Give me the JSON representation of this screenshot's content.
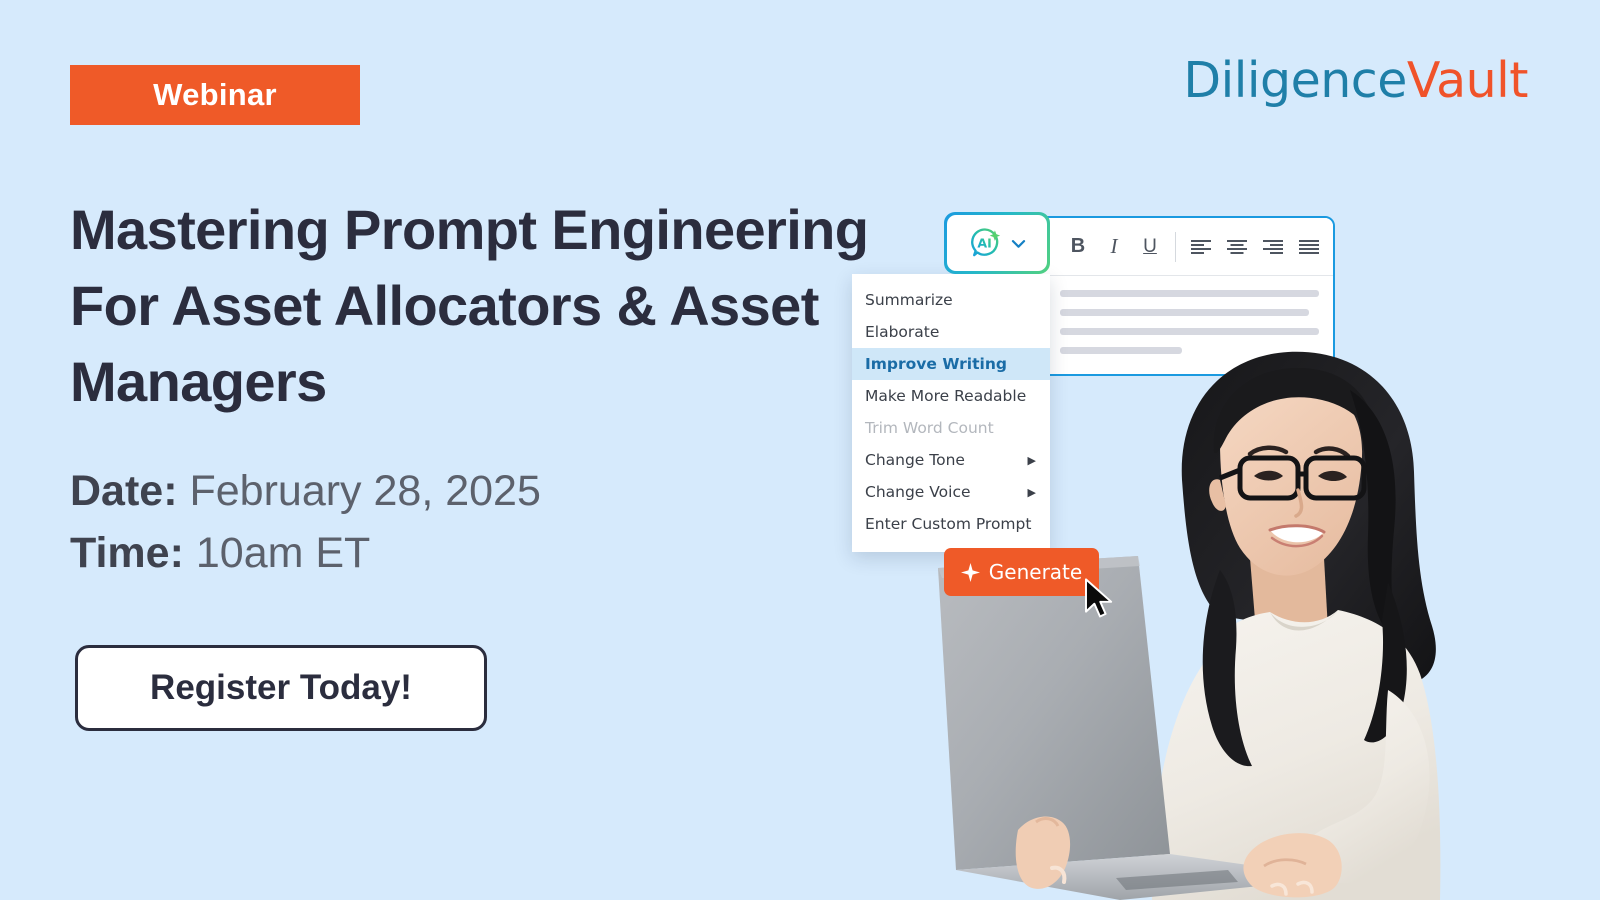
{
  "theme": {
    "background": "#d6eafc",
    "orange": "#ef5a28",
    "headline_color": "#2b2d3e",
    "logo_blue": "#1f7fa8",
    "logo_orange": "#f0532a",
    "card_border_blue": "#1b9ae0",
    "menu_highlight_bg": "#cfe7f8",
    "menu_highlight_text": "#1a6ca6"
  },
  "badge": {
    "label": "Webinar"
  },
  "logo": {
    "part_a": "Diligence",
    "part_b": "Vault"
  },
  "headline": {
    "line1": "Mastering Prompt Engineering",
    "line2": "For Asset Allocators & Asset",
    "line3": "Managers"
  },
  "details": {
    "date_label": "Date:",
    "date_value": "February 28, 2025",
    "time_label": "Time:",
    "time_value": "10am ET"
  },
  "cta": {
    "label": "Register Today!"
  },
  "ai_widget": {
    "button_icon": "ai-sparkle-icon",
    "button_text": "AI",
    "chevron_icon": "chevron-down-icon",
    "menu_items": [
      {
        "label": "Summarize",
        "state": "normal",
        "submenu": false
      },
      {
        "label": "Elaborate",
        "state": "normal",
        "submenu": false
      },
      {
        "label": "Improve Writing",
        "state": "selected",
        "submenu": false
      },
      {
        "label": "Make More Readable",
        "state": "normal",
        "submenu": false
      },
      {
        "label": "Trim Word Count",
        "state": "disabled",
        "submenu": false
      },
      {
        "label": "Change Tone",
        "state": "normal",
        "submenu": true
      },
      {
        "label": "Change Voice",
        "state": "normal",
        "submenu": true
      },
      {
        "label": "Enter Custom Prompt",
        "state": "normal",
        "submenu": false
      }
    ],
    "submenu_arrow": "▶",
    "generate": {
      "label": "Generate",
      "icon": "sparkle-icon"
    }
  },
  "editor": {
    "toolbar": [
      {
        "name": "bold-button",
        "label": "B"
      },
      {
        "name": "italic-button",
        "label": "I"
      },
      {
        "name": "underline-button",
        "label": "U"
      },
      {
        "name": "align-left-button",
        "label": ""
      },
      {
        "name": "align-center-button",
        "label": ""
      },
      {
        "name": "align-right-button",
        "label": ""
      },
      {
        "name": "align-justify-button",
        "label": ""
      }
    ],
    "placeholder_lines": [
      100,
      96,
      100,
      47
    ]
  }
}
